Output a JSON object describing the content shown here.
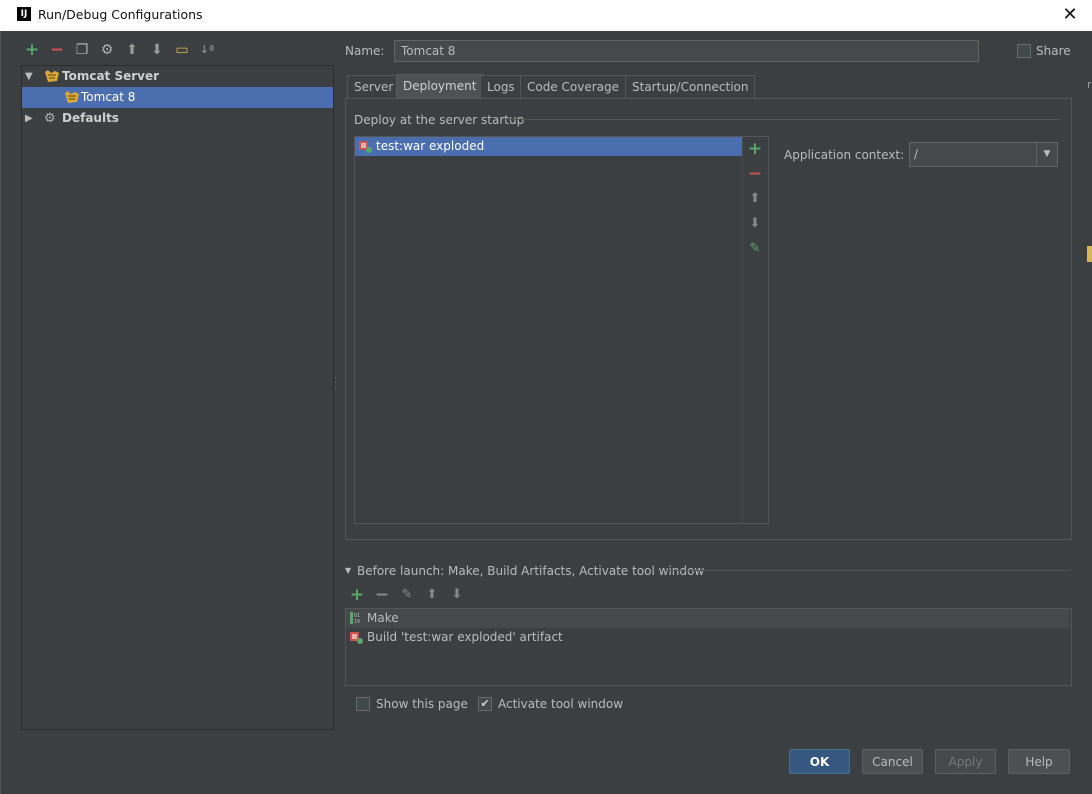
{
  "window": {
    "title": "Run/Debug Configurations",
    "app_logo": "IJ"
  },
  "toolbar": {
    "icons": [
      "add-icon",
      "remove-icon",
      "copy-icon",
      "edit-defaults-icon",
      "arrow-up-icon",
      "arrow-down-icon",
      "folder-icon",
      "sort-icon"
    ]
  },
  "tree": {
    "group": "Tomcat Server",
    "child": "Tomcat 8",
    "defaults": "Defaults"
  },
  "name": {
    "label": "Name:",
    "value": "Tomcat 8"
  },
  "share": {
    "label": "Share",
    "checked": false
  },
  "tabs": [
    "Server",
    "Deployment",
    "Logs",
    "Code Coverage",
    "Startup/Connection"
  ],
  "active_tab": "Deployment",
  "deployment": {
    "group_label": "Deploy at the server startup",
    "items": [
      "test:war exploded"
    ],
    "app_context_label": "Application context:",
    "app_context_value": "/"
  },
  "before_launch": {
    "label": "Before launch: Make, Build Artifacts, Activate tool window",
    "items": [
      "Make",
      "Build 'test:war exploded' artifact"
    ]
  },
  "show_page": {
    "label": "Show this page",
    "checked": false
  },
  "activate_tool_window": {
    "label": "Activate tool window",
    "checked": true
  },
  "buttons": {
    "ok": "OK",
    "cancel": "Cancel",
    "apply": "Apply",
    "help": "Help"
  },
  "colors": {
    "selection": "#4b6eaf",
    "background": "#3c3f41",
    "add": "#59a869",
    "remove": "#c75450",
    "ok": "#365880"
  }
}
